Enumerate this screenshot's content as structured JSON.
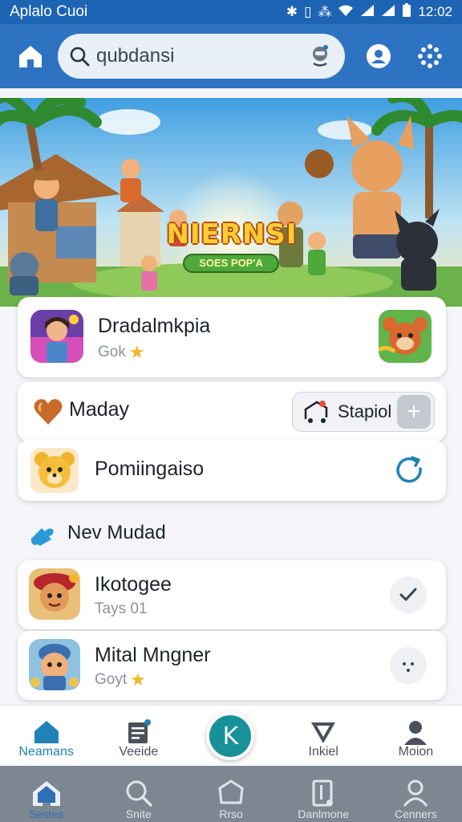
{
  "status_bar": {
    "app_name": "Aplalo Cuoi",
    "time": "12:02"
  },
  "search": {
    "placeholder": "qubdansi"
  },
  "banner": {
    "title": "NIERNSI",
    "subtitle": "SOES POP'A"
  },
  "featured": {
    "title": "Dradalmkpia",
    "subtitle": "Gok",
    "star": "★"
  },
  "rows": [
    {
      "title": "Maday",
      "action_label": "Stapiol",
      "action_plus": "+"
    },
    {
      "title": "Pomiingaiso"
    }
  ],
  "section": {
    "title": "Nev Mudad"
  },
  "list": [
    {
      "title": "Ikotogee",
      "subtitle": "Tays 01"
    },
    {
      "title": "Mital Mngner",
      "subtitle": "Goyt",
      "star": "★"
    }
  ],
  "bottom_nav": {
    "items": [
      {
        "label": "Neamans"
      },
      {
        "label": "Veeide"
      },
      {
        "label": "Inkiel"
      },
      {
        "label": "Moion"
      }
    ],
    "fab_label": "K"
  },
  "system_nav": {
    "items": [
      {
        "label": "Sestes"
      },
      {
        "label": "Snite"
      },
      {
        "label": "Rrso"
      },
      {
        "label": "Danlmone"
      },
      {
        "label": "Cenners"
      }
    ]
  },
  "colors": {
    "primary": "#2d73c2",
    "status": "#1e64b4",
    "accent": "#17919a",
    "system_bar": "#7d8791"
  }
}
